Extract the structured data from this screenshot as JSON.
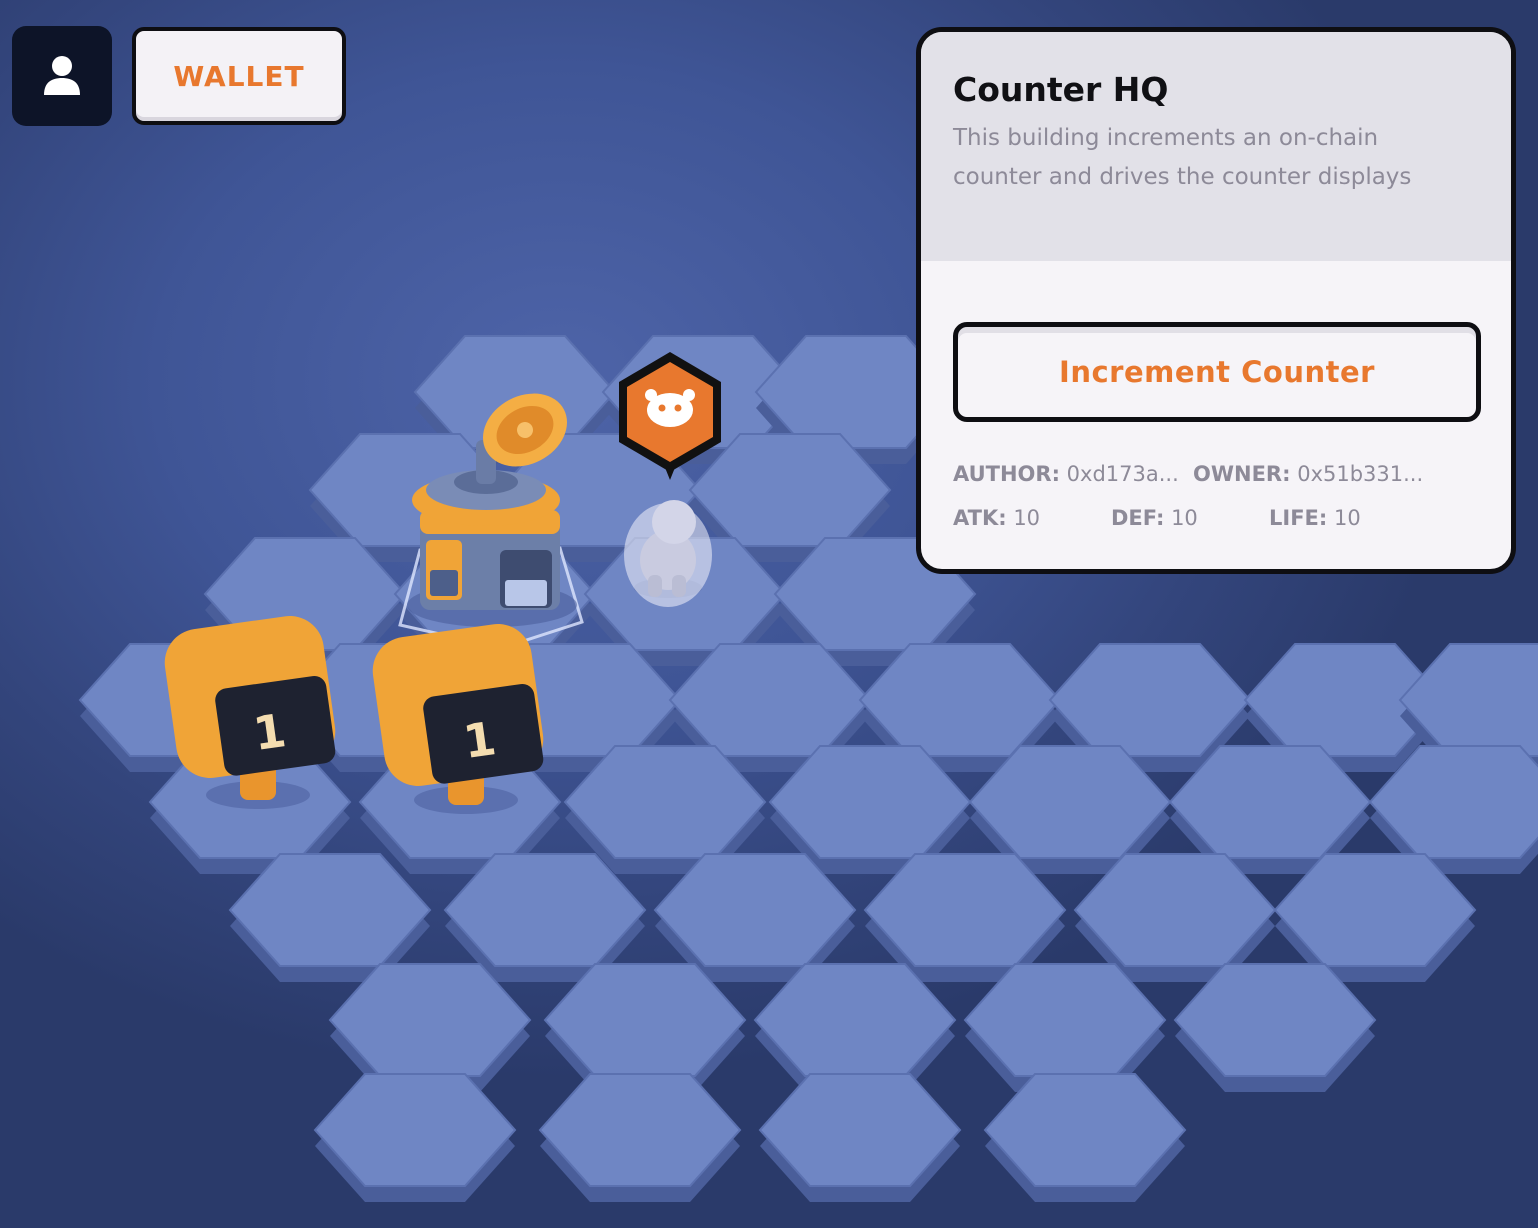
{
  "hud": {
    "profile_icon": "user-icon",
    "wallet_label": "WALLET"
  },
  "panel": {
    "title": "Counter HQ",
    "description": "This building increments an on-chain counter and drives the counter displays",
    "action_label": "Increment Counter",
    "author_label": "AUTHOR:",
    "author_value": "0xd173a...",
    "owner_label": "OWNER:",
    "owner_value": "0x51b331...",
    "atk_label": "ATK:",
    "atk_value": "10",
    "def_label": "DEF:",
    "def_value": "10",
    "life_label": "LIFE:",
    "life_value": "10"
  },
  "board": {
    "counter_displays": [
      {
        "value": "1"
      },
      {
        "value": "1"
      }
    ],
    "unit_marker_icon": "bot-face-icon",
    "building_icon": "satellite-building-icon",
    "colors": {
      "accent": "#e8782e",
      "tile": "#6f86c4",
      "background": "#3f5596"
    }
  }
}
